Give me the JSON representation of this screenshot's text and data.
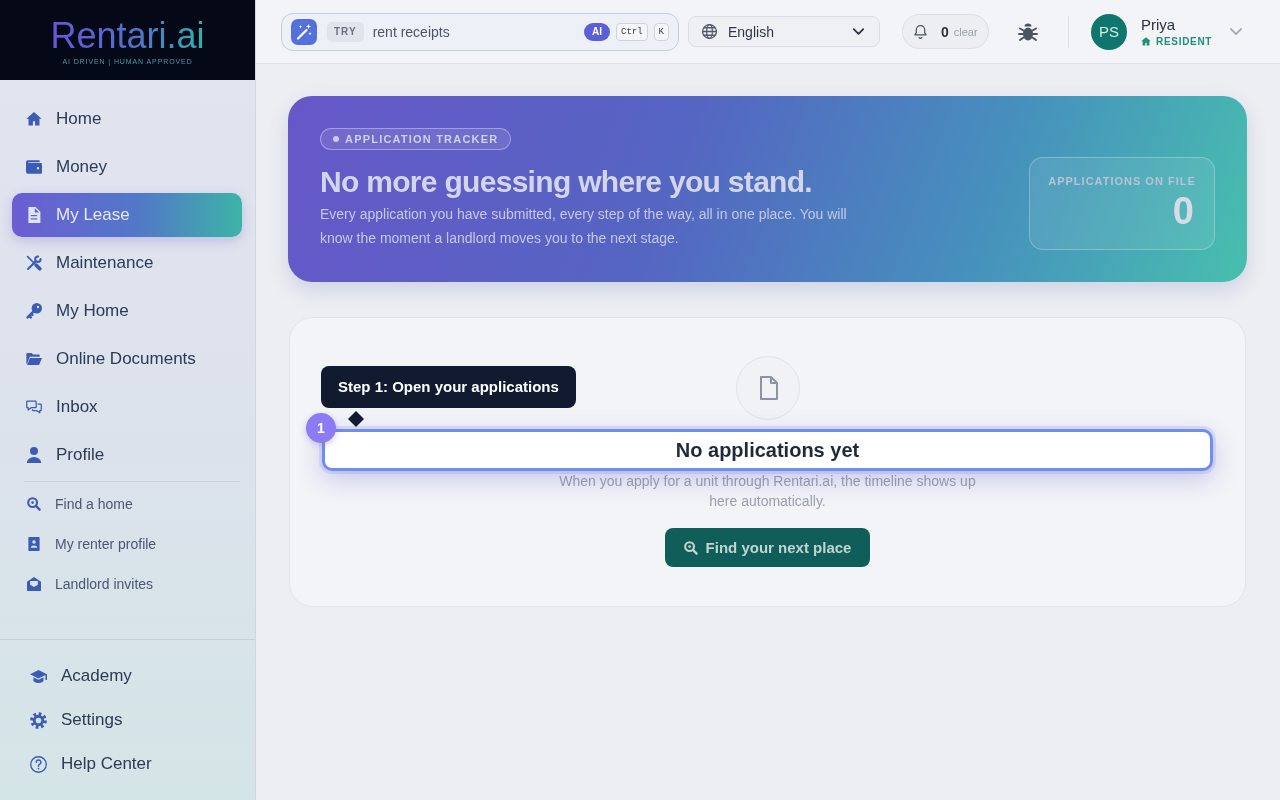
{
  "brand": {
    "name": "Rentari.ai",
    "tagline": "AI DRIVEN | HUMAN APPROVED"
  },
  "sidebar": {
    "main": [
      {
        "label": "Home",
        "selected": false
      },
      {
        "label": "Money",
        "selected": false
      },
      {
        "label": "My Lease",
        "selected": true
      },
      {
        "label": "Maintenance",
        "selected": false
      },
      {
        "label": "My Home",
        "selected": false
      },
      {
        "label": "Online Documents",
        "selected": false
      },
      {
        "label": "Inbox",
        "selected": false
      },
      {
        "label": "Profile",
        "selected": false
      }
    ],
    "links": [
      {
        "label": "Find a home",
        "selected": false
      },
      {
        "label": "My renter profile",
        "selected": false
      },
      {
        "label": "Landlord invites",
        "selected": false
      }
    ],
    "footer": [
      {
        "label": "Academy",
        "selected": false
      },
      {
        "label": "Settings",
        "selected": false
      },
      {
        "label": "Help Center",
        "selected": false
      }
    ]
  },
  "topbar": {
    "search": {
      "badge": "TRY",
      "placeholder": "rent receipts",
      "ai_badge": "AI",
      "shortcut": [
        "Ctrl",
        "K"
      ]
    },
    "language": {
      "value": "English"
    },
    "notifications": {
      "count": "0",
      "action": "clear"
    },
    "user": {
      "initials": "PS",
      "name": "Priya",
      "role": "RESIDENT"
    }
  },
  "hero": {
    "badge": "APPLICATION TRACKER",
    "title": "No more guessing where you stand.",
    "text": "Every application you have submitted, every step of the way, all in one place. You will know the moment a landlord moves you to the next stage.",
    "stat": {
      "label": "APPLICATIONS ON FILE",
      "value": "0"
    }
  },
  "empty_state": {
    "title": "No applications yet",
    "text": "When you apply for a unit through Rentari.ai, the timeline shows up here automatically.",
    "button": "Find your next place"
  },
  "tour": {
    "step": "1",
    "tooltip": "Step 1: Open your applications"
  }
}
